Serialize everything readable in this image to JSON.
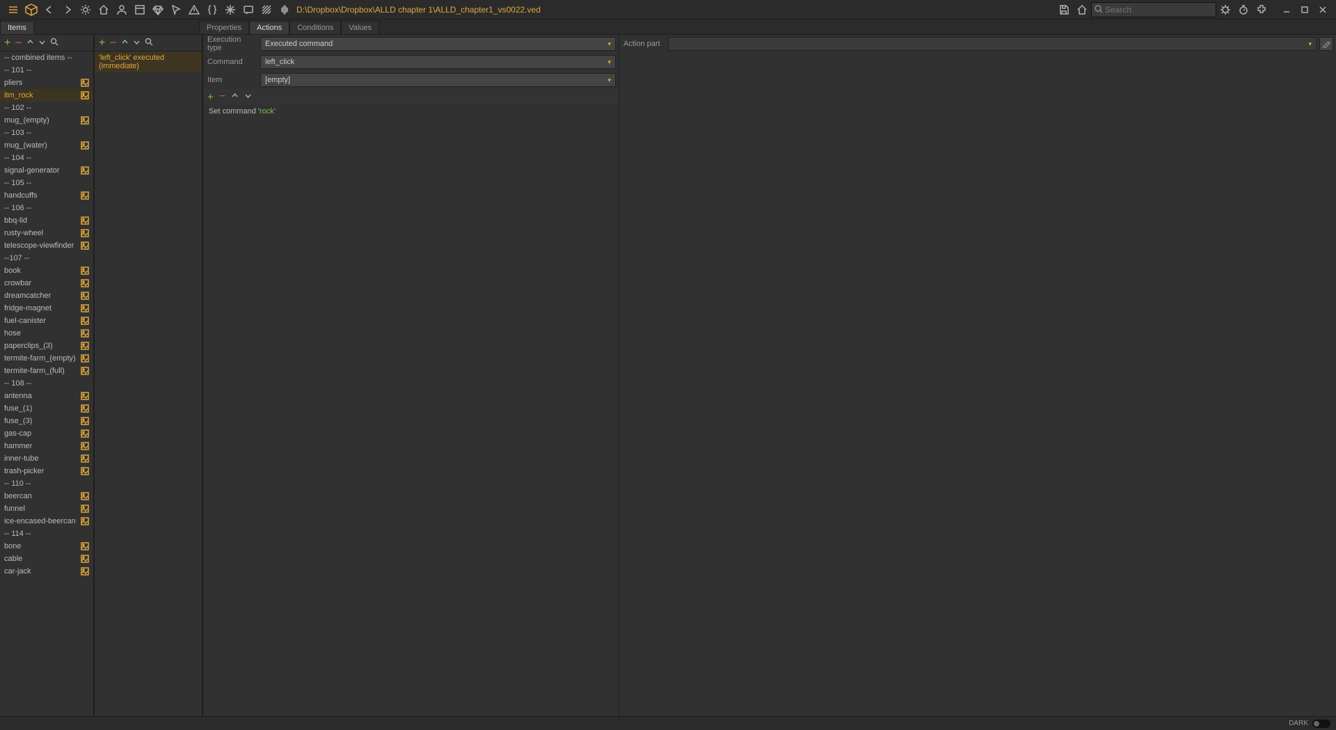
{
  "file_path": "D:\\Dropbox\\Dropbox\\ALLD chapter 1\\ALLD_chapter1_vs0022.ved",
  "search_placeholder": "Search",
  "left_panel_tab": "Items",
  "mid_tabs": {
    "properties": "Properties",
    "actions": "Actions",
    "conditions": "Conditions",
    "values": "Values"
  },
  "items": [
    {
      "label": "-- combined items --",
      "img": false,
      "sel": false
    },
    {
      "label": "-- 101 --",
      "img": false,
      "sel": false
    },
    {
      "label": "pliers",
      "img": true,
      "sel": false
    },
    {
      "label": "itm_rock",
      "img": true,
      "sel": true
    },
    {
      "label": "-- 102 --",
      "img": false,
      "sel": false
    },
    {
      "label": "mug_(empty)",
      "img": true,
      "sel": false
    },
    {
      "label": "-- 103 --",
      "img": false,
      "sel": false
    },
    {
      "label": "mug_(water)",
      "img": true,
      "sel": false
    },
    {
      "label": "-- 104 --",
      "img": false,
      "sel": false
    },
    {
      "label": "signal-generator",
      "img": true,
      "sel": false
    },
    {
      "label": "-- 105 --",
      "img": false,
      "sel": false
    },
    {
      "label": "handcuffs",
      "img": true,
      "sel": false
    },
    {
      "label": "-- 106 --",
      "img": false,
      "sel": false
    },
    {
      "label": "bbq-lid",
      "img": true,
      "sel": false
    },
    {
      "label": "rusty-wheel",
      "img": true,
      "sel": false
    },
    {
      "label": "telescope-viewfinder",
      "img": true,
      "sel": false
    },
    {
      "label": "--107 --",
      "img": false,
      "sel": false
    },
    {
      "label": "book",
      "img": true,
      "sel": false
    },
    {
      "label": "crowbar",
      "img": true,
      "sel": false
    },
    {
      "label": "dreamcatcher",
      "img": true,
      "sel": false
    },
    {
      "label": "fridge-magnet",
      "img": true,
      "sel": false
    },
    {
      "label": "fuel-canister",
      "img": true,
      "sel": false
    },
    {
      "label": "hose",
      "img": true,
      "sel": false
    },
    {
      "label": "paperclips_(3)",
      "img": true,
      "sel": false
    },
    {
      "label": "termite-farm_(empty)",
      "img": true,
      "sel": false
    },
    {
      "label": "termite-farm_(full)",
      "img": true,
      "sel": false
    },
    {
      "label": "-- 108 --",
      "img": false,
      "sel": false
    },
    {
      "label": "antenna",
      "img": true,
      "sel": false
    },
    {
      "label": "fuse_(1)",
      "img": true,
      "sel": false
    },
    {
      "label": "fuse_(3)",
      "img": true,
      "sel": false
    },
    {
      "label": "gas-cap",
      "img": true,
      "sel": false
    },
    {
      "label": "hammer",
      "img": true,
      "sel": false
    },
    {
      "label": "inner-tube",
      "img": true,
      "sel": false
    },
    {
      "label": "trash-picker",
      "img": true,
      "sel": false
    },
    {
      "label": "-- 110 --",
      "img": false,
      "sel": false
    },
    {
      "label": "beercan",
      "img": true,
      "sel": false
    },
    {
      "label": "funnel",
      "img": true,
      "sel": false
    },
    {
      "label": "ice-encased-beercan",
      "img": true,
      "sel": false
    },
    {
      "label": "-- 114 --",
      "img": false,
      "sel": false
    },
    {
      "label": "bone",
      "img": true,
      "sel": false
    },
    {
      "label": "cable",
      "img": true,
      "sel": false
    },
    {
      "label": "car-jack",
      "img": true,
      "sel": false
    }
  ],
  "actions": [
    {
      "label": "'left_click' executed (immediate)",
      "sel": true
    }
  ],
  "fields": {
    "execution_type": {
      "label": "Execution type",
      "value": "Executed command"
    },
    "command": {
      "label": "Command",
      "value": "left_click"
    },
    "item": {
      "label": "Item",
      "value": "[empty]"
    }
  },
  "cmd_line_prefix": "Set command '",
  "cmd_line_value": "rock",
  "cmd_line_suffix": "'",
  "action_part_label": "Action part",
  "theme_label": "DARK"
}
